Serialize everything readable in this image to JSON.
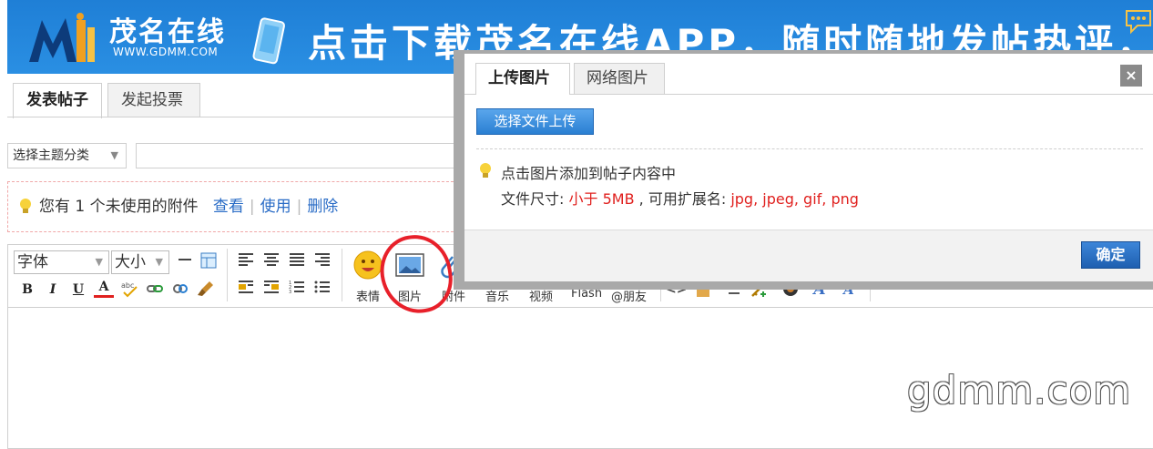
{
  "banner": {
    "logo_cn": "茂名在线",
    "logo_url": "WWW.GDMM.COM",
    "slogan": "点击下载茂名在线APP，随时随地发帖热评，"
  },
  "tabs": {
    "post": "发表帖子",
    "vote": "发起投票"
  },
  "topic": {
    "category": "选择主题分类",
    "title_value": ""
  },
  "notice": {
    "prefix": "您有 1 个未使用的附件",
    "view": "查看",
    "use": "使用",
    "delete": "删除",
    "sep": "|"
  },
  "editor": {
    "font_select": "字体",
    "size_select": "大小",
    "buttons": {
      "emoji": "表情",
      "image": "图片",
      "attachment": "附件",
      "music": "音乐",
      "video": "视频",
      "flash": "Flash",
      "mention": "@朋友"
    },
    "format": {
      "bold": "B",
      "italic": "I",
      "underline": "U",
      "color": "A"
    }
  },
  "dialog": {
    "tab_upload": "上传图片",
    "tab_network": "网络图片",
    "close": "×",
    "upload_button": "选择文件上传",
    "hint": "点击图片添加到帖子内容中",
    "size_label": "文件尺寸:",
    "size_value": "小于 5MB",
    "ext_label": ", 可用扩展名:",
    "ext_value": "jpg, jpeg, gif, png",
    "confirm": "确定"
  },
  "watermark": "gdmm.com",
  "colors": {
    "banner": "#2a8fe3",
    "link": "#2a6cc6",
    "warning": "#e0201e",
    "primary_button": "#1e5fb0",
    "annotation": "#e8202a"
  }
}
